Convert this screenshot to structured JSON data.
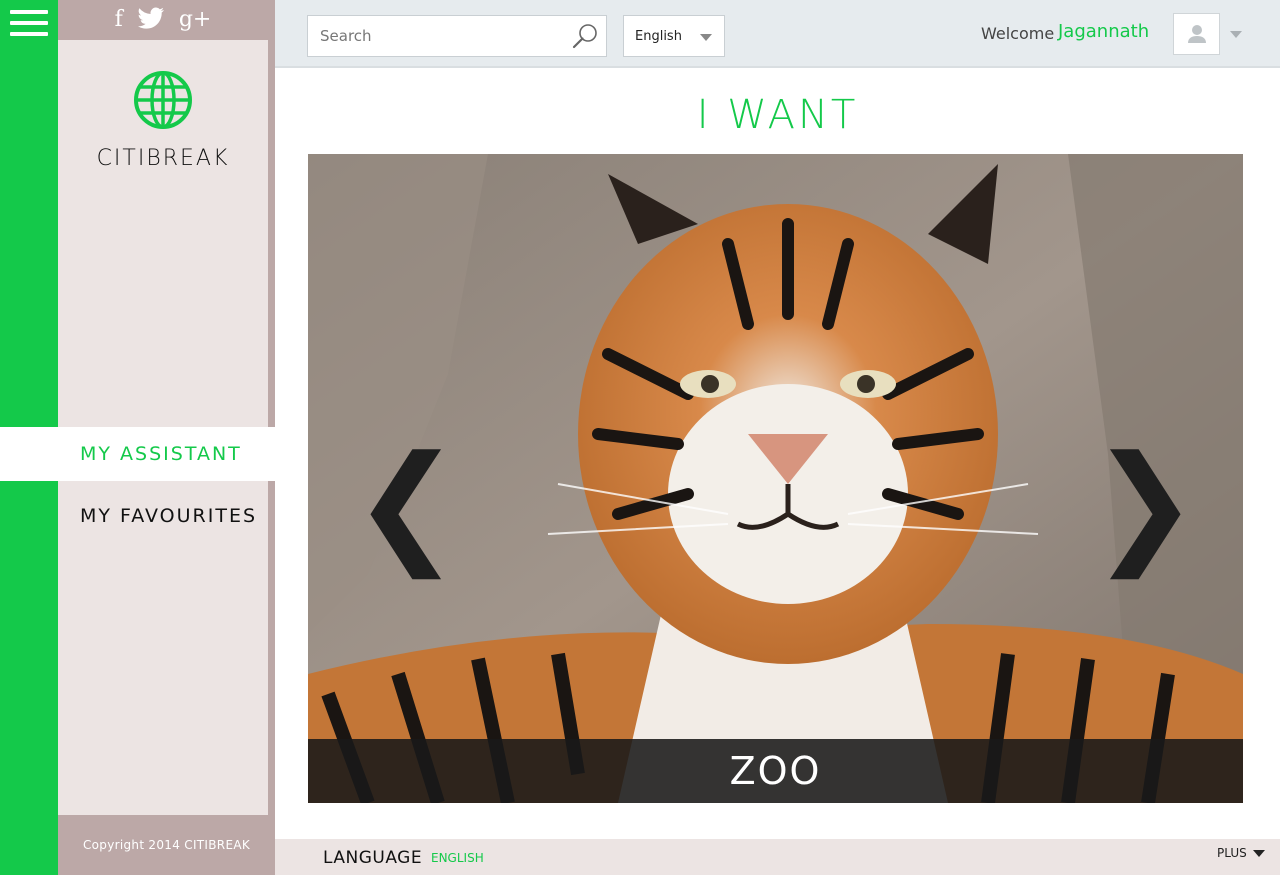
{
  "colors": {
    "brand_green": "#14c94a",
    "sidebar_bg": "#bca8a7",
    "panel_bg": "#ece4e3",
    "topbar_bg": "#e6ebee"
  },
  "social": {
    "facebook": "f",
    "twitter_icon": "twitter-bird-icon",
    "google_plus": "g+"
  },
  "brand": {
    "logo_icon": "globe-icon",
    "name": "CITIBREAK"
  },
  "nav": {
    "items": [
      {
        "label": "MY  ASSISTANT",
        "active": true
      },
      {
        "label": "MY  FAVOURITES",
        "active": false
      }
    ]
  },
  "copyright": "Copyright  2014   CITIBREAK",
  "search": {
    "placeholder": "Search",
    "value": ""
  },
  "language_select": {
    "selected": "English"
  },
  "user": {
    "welcome": "Welcome",
    "name": "Jagannath"
  },
  "main": {
    "heading": "I  WANT",
    "slide": {
      "caption": "ZOO",
      "image": "tiger-photo"
    },
    "prev_glyph": "❮",
    "next_glyph": "❯"
  },
  "footer": {
    "language_label": "LANGUAGE",
    "language_value": "ENGLISH",
    "plus_label": "PLUS"
  }
}
